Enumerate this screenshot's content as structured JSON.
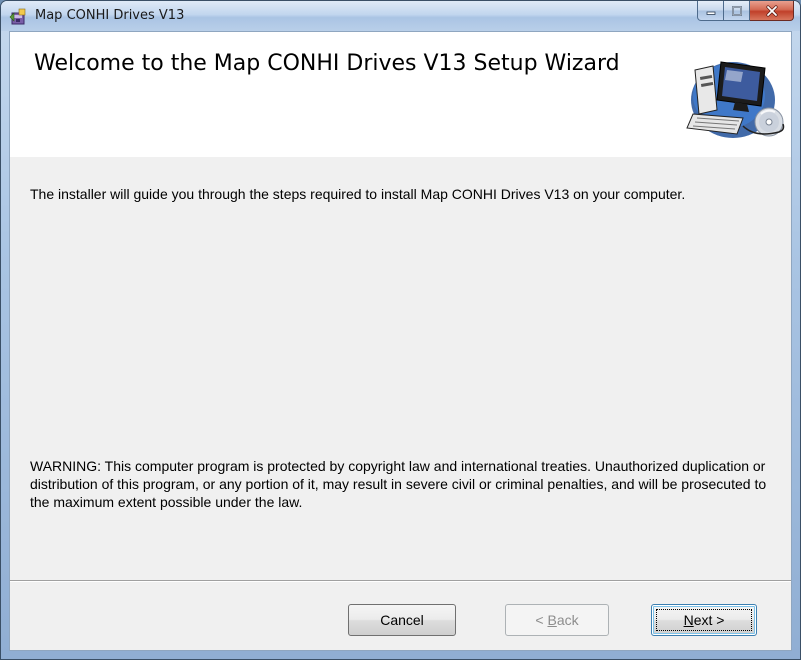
{
  "window": {
    "title": "Map CONHI Drives V13",
    "buttons": {
      "minimize": "minimize-icon",
      "maximize": "maximize-icon",
      "close": "close-icon"
    }
  },
  "banner": {
    "title": "Welcome to the Map CONHI Drives V13 Setup Wizard",
    "graphic": "computer-setup-icon"
  },
  "body": {
    "intro": "The installer will guide you through the steps required to install Map CONHI Drives V13 on your computer.",
    "warning": "WARNING: This computer program is protected by copyright law and international treaties. Unauthorized duplication or distribution of this program, or any portion of it, may result in severe civil or criminal penalties, and will be prosecuted to the maximum extent possible under the law."
  },
  "footer": {
    "cancel_label": "Cancel",
    "back_label": "< Back",
    "back_mnemonic": "B",
    "back_enabled": false,
    "next_label": "Next >",
    "next_mnemonic": "N",
    "next_default": true
  },
  "colors": {
    "client_background": "#f0f0f0",
    "banner_background": "#ffffff",
    "close_button": "#c0402a",
    "disabled_text": "#8d8d8d"
  }
}
